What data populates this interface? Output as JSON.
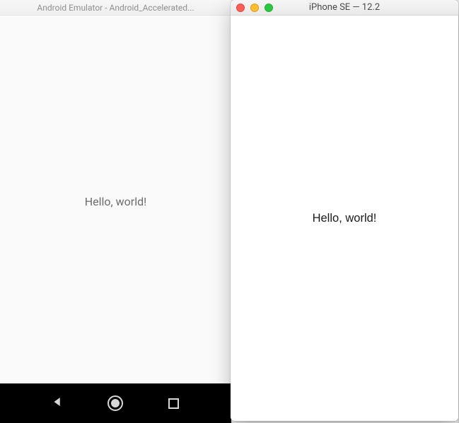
{
  "android": {
    "window_title": "Android Emulator - Android_Accelerated...",
    "body_text": "Hello, world!",
    "nav": {
      "back": "back-triangle",
      "home": "home-circle",
      "recent": "recent-square"
    }
  },
  "ios": {
    "window_title": "iPhone SE — 12.2",
    "body_text": "Hello, world!",
    "traffic_lights": {
      "close": "#ff5f57",
      "minimize": "#ffbd2e",
      "maximize": "#28c940"
    }
  }
}
